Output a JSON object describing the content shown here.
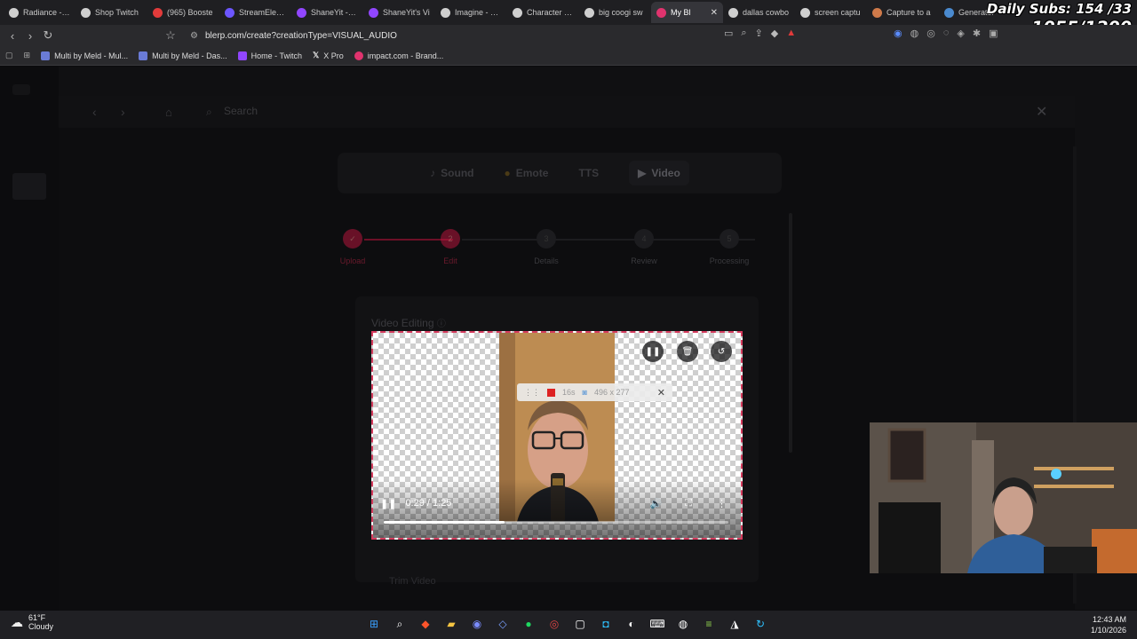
{
  "browser": {
    "tabs": [
      {
        "label": "Radiance - Fu",
        "color": "#cfcfcf",
        "active": false
      },
      {
        "label": "Shop Twitch",
        "color": "#cfcfcf",
        "active": false
      },
      {
        "label": "(965) Booste",
        "color": "#e23b3b",
        "active": false
      },
      {
        "label": "StreamEleme",
        "color": "#6c56ff",
        "active": false
      },
      {
        "label": "ShaneYit - Ch",
        "color": "#9146ff",
        "active": false
      },
      {
        "label": "ShaneYit's Vi",
        "color": "#9146ff",
        "active": false
      },
      {
        "label": "Imagine - Gro",
        "color": "#cfcfcf",
        "active": false
      },
      {
        "label": "Character De",
        "color": "#cfcfcf",
        "active": false
      },
      {
        "label": "big coogi sw",
        "color": "#cfcfcf",
        "active": false
      },
      {
        "label": "My Bl",
        "color": "#e0336e",
        "active": true
      },
      {
        "label": "dallas cowbo",
        "color": "#cfcfcf",
        "active": false
      },
      {
        "label": "screen captu",
        "color": "#cfcfcf",
        "active": false
      },
      {
        "label": "Capture to a",
        "color": "#cf7a4a",
        "active": false
      },
      {
        "label": "Generator",
        "color": "#4a8acf",
        "active": false
      }
    ],
    "url": "blerp.com/create?creationType=VISUAL_AUDIO",
    "bookmarks": [
      "Multi by Meld - Mul...",
      "Multi by Meld - Das...",
      "Home - Twitch",
      "X Pro",
      "impact.com - Brand..."
    ]
  },
  "overlay": {
    "daily_subs": "Daily Subs: 154 /33",
    "goal": "1055/1200"
  },
  "page": {
    "search_placeholder": "Search",
    "types": [
      {
        "label": "Sound",
        "selected": false
      },
      {
        "label": "Emote",
        "selected": false
      },
      {
        "label": "TTS",
        "selected": false
      },
      {
        "label": "Video",
        "selected": true
      }
    ],
    "steps": [
      {
        "label": "Upload",
        "state": "done"
      },
      {
        "label": "Edit",
        "state": "current"
      },
      {
        "label": "Details",
        "state": "todo"
      },
      {
        "label": "Review",
        "state": "todo"
      },
      {
        "label": "Processing",
        "state": "todo"
      }
    ],
    "section_title": "Video Editing",
    "next_section_title": "Trim Video"
  },
  "video": {
    "rec_duration": "16s",
    "rec_size": "496 x 277",
    "current_time": "0:29",
    "duration": "1:25",
    "time_display": "0:29 / 1:25",
    "progress": 0.35
  },
  "taskbar": {
    "temperature": "61°F",
    "condition": "Cloudy",
    "time": "12:43 AM",
    "date": "1/10/2026"
  },
  "colors": {
    "accent": "#d43b5d",
    "step_done": "#b3163c"
  }
}
